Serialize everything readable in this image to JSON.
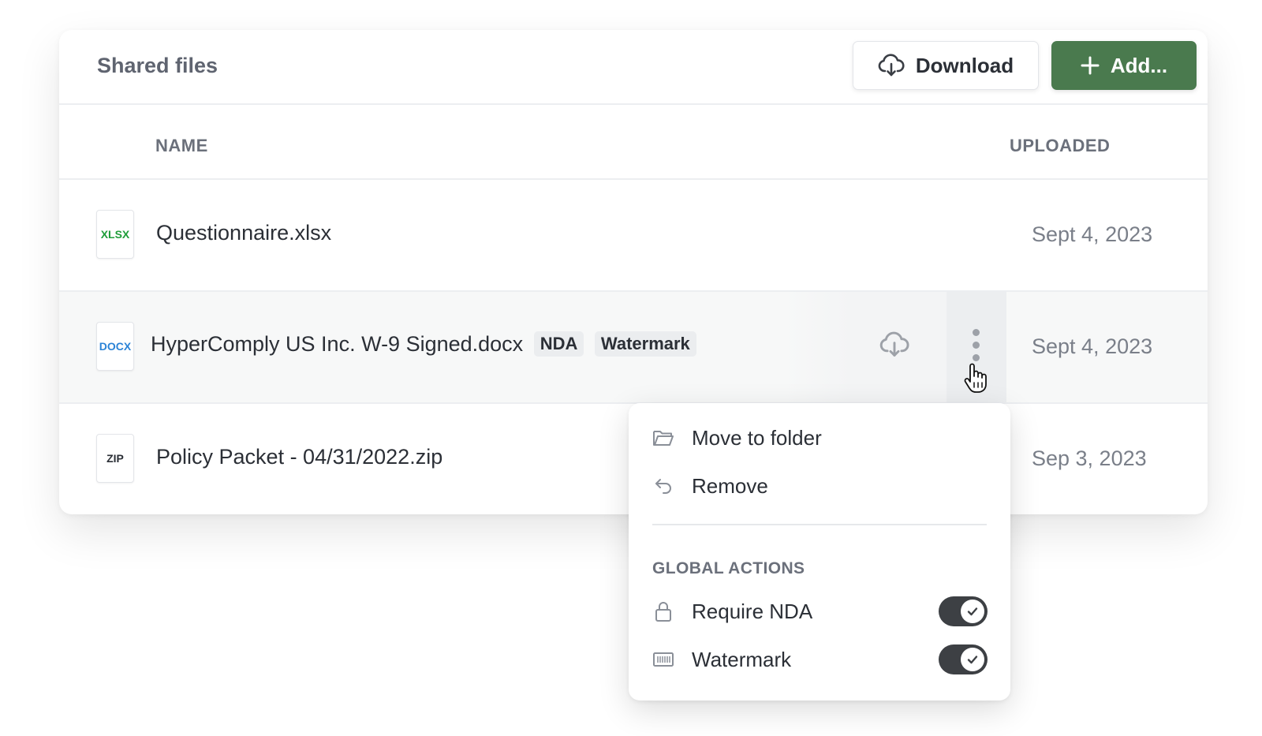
{
  "header": {
    "title": "Shared files",
    "download_label": "Download",
    "add_label": "Add..."
  },
  "columns": {
    "name": "NAME",
    "uploaded": "UPLOADED"
  },
  "files": [
    {
      "type_label": "XLSX",
      "type_color": "#1f9d3a",
      "name": "Questionnaire.xlsx",
      "tags": [],
      "uploaded": "Sept 4, 2023"
    },
    {
      "type_label": "DOCX",
      "type_color": "#2b83d6",
      "name": "HyperComply US Inc. W-9 Signed.docx",
      "tags": [
        "NDA",
        "Watermark"
      ],
      "uploaded": "Sept 4, 2023"
    },
    {
      "type_label": "ZIP",
      "type_color": "#2b2f36",
      "name": "Policy Packet - 04/31/2022.zip",
      "tags": [],
      "uploaded": "Sep 3, 2023"
    }
  ],
  "menu": {
    "move_label": "Move to folder",
    "remove_label": "Remove",
    "section_label": "GLOBAL ACTIONS",
    "require_nda_label": "Require NDA",
    "require_nda_on": true,
    "watermark_label": "Watermark",
    "watermark_on": true
  },
  "colors": {
    "accent": "#4a7a4e",
    "toggle_on": "#3d4044"
  }
}
